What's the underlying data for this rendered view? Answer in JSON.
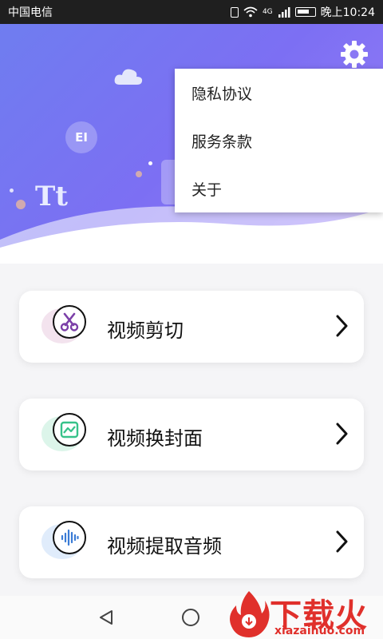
{
  "status_bar": {
    "carrier": "中国电信",
    "network": "4G",
    "time": "晚上10:24"
  },
  "settings_icon": "gear-icon",
  "header_decorations": {
    "badge_text": "EI",
    "tt_text": "Tt"
  },
  "menu": {
    "items": [
      {
        "label": "隐私协议"
      },
      {
        "label": "服务条款"
      },
      {
        "label": "关于"
      }
    ]
  },
  "features": [
    {
      "label": "视频剪切",
      "icon": "scissors-icon",
      "accent": "#7b3fa8",
      "blob": "#f3e3ee"
    },
    {
      "label": "视频换封面",
      "icon": "image-icon",
      "accent": "#37c28a",
      "blob": "#dcf5ea"
    },
    {
      "label": "视频提取音频",
      "icon": "audio-wave-icon",
      "accent": "#3a7bd5",
      "blob": "#e0ecfb"
    }
  ],
  "watermark": {
    "text": "下载火",
    "url": "xiazaihuo.com"
  },
  "colors": {
    "header_gradient_start": "#6f7df0",
    "header_gradient_end": "#9a7ff6",
    "watermark_red": "#e0302b"
  }
}
